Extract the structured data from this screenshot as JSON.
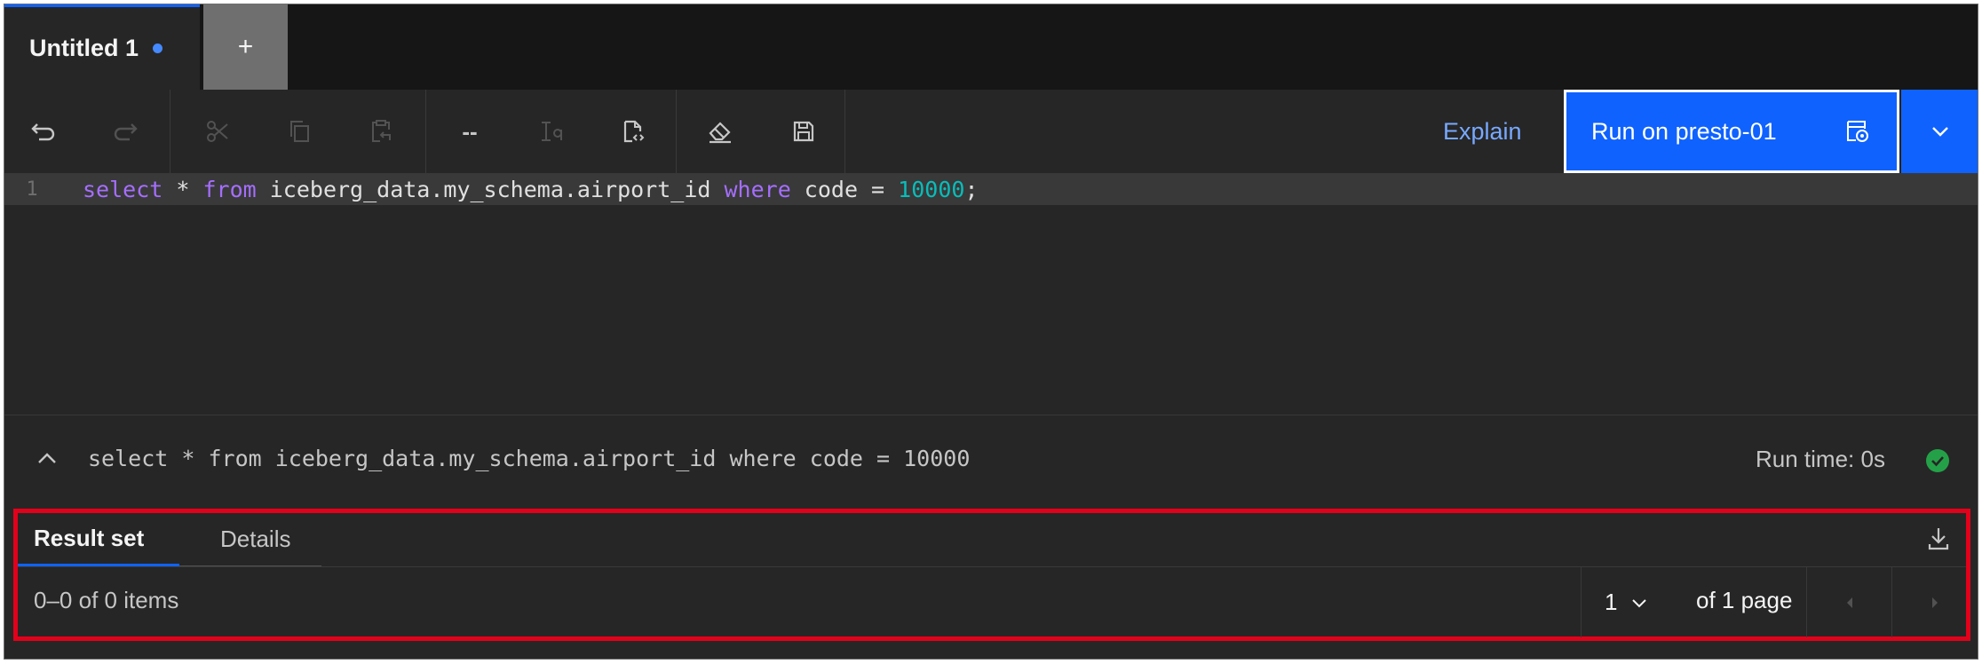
{
  "tabs": {
    "active_label": "Untitled 1",
    "add_label": "+"
  },
  "toolbar": {
    "explain_label": "Explain",
    "run_label": "Run on presto-01",
    "comment_label": "--"
  },
  "editor": {
    "line_number": "1",
    "tokens": {
      "t1": "select",
      "t2": " * ",
      "t3": "from",
      "t4": " iceberg_data.my_schema.airport_id ",
      "t5": "where",
      "t6": " code = ",
      "t7": "10000",
      "t8": ";"
    }
  },
  "summary": {
    "query_text": "select * from iceberg_data.my_schema.airport_id where code = 10000",
    "run_time": "Run time: 0s"
  },
  "results": {
    "tabs": [
      "Result set",
      "Details"
    ],
    "items_label": "0–0 of 0 items",
    "page_value": "1",
    "page_of_label": "of 1 page"
  },
  "colors": {
    "accent": "#0f62fe",
    "success": "#24a148",
    "highlight_border": "#e2001a",
    "keyword": "#a56eff",
    "number": "#08bdba"
  }
}
